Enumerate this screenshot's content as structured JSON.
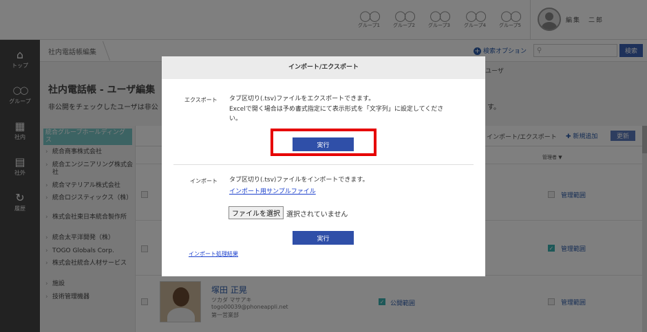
{
  "header": {
    "groups": [
      {
        "label": "グループ1"
      },
      {
        "label": "グループ2"
      },
      {
        "label": "グループ3"
      },
      {
        "label": "グループ4"
      },
      {
        "label": "グループ5"
      }
    ],
    "user_name": "編集　二郎"
  },
  "leftnav": {
    "items": [
      {
        "label": "トップ",
        "icon": "home-icon"
      },
      {
        "label": "グループ",
        "icon": "group-icon"
      },
      {
        "label": "社内",
        "icon": "book-icon"
      },
      {
        "label": "社外",
        "icon": "card-icon"
      },
      {
        "label": "履歴",
        "icon": "history-icon"
      }
    ]
  },
  "breadcrumb": {
    "current": "社内電話帳編集"
  },
  "search": {
    "option_label": "検索オプション",
    "placeholder": "",
    "button_label": "検索"
  },
  "page": {
    "title": "社内電話帳 - ユーザ編集",
    "desc_left": "非公開をチェックしたユーザは非公",
    "desc_right": "す。",
    "user_tab": "ユーザ"
  },
  "tree": {
    "root": "統合グループホールディングス",
    "items": [
      "統合商事株式会社",
      "統合エンジニアリング株式会社",
      "統合マテリアル株式会社",
      "統合ロジスティックス（株）",
      "株式会社東日本統合製作所",
      "統合太平洋開発（株）",
      "TOGO Globals Corp.",
      "株式会社統合人材サービス",
      "施設",
      "技術管理機器"
    ]
  },
  "list": {
    "import_export_link": "インポート/エクスポート",
    "add_link": "新規追加",
    "refresh_button": "更新",
    "admin_header": "管理者",
    "manage_label": "管理範囲",
    "public_label": "公開範囲",
    "person": {
      "name": "塚田 正晃",
      "kana": "ツカダ マサアキ",
      "email": "togo00039@phoneappli.net",
      "dept": "第一営業部"
    }
  },
  "modal": {
    "title": "インポート/エクスポート",
    "export": {
      "label": "エクスポート",
      "line1": "タブ区切り(.tsv)ファイルをエクスポートできます。",
      "line2": "Excelで開く場合は予め書式指定にて表示形式を「文字列」に設定してくださ",
      "line3": "い。",
      "button": "実行"
    },
    "import": {
      "label": "インポート",
      "line1": "タブ区切り(.tsv)ファイルをインポートできます。",
      "sample_link": "インポート用サンプルファイル",
      "file_button": "ファイルを選択",
      "file_none": "選択されていません",
      "button": "実行"
    },
    "result_link": "インポート処理結果"
  }
}
